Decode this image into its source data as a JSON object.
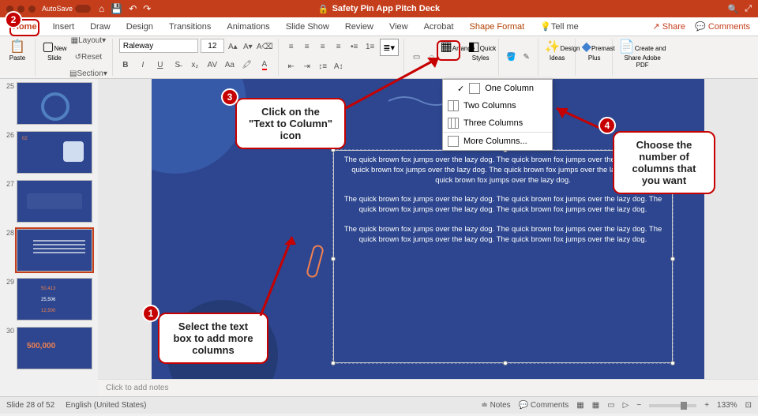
{
  "titlebar": {
    "autosave": "AutoSave",
    "doc": "Safety Pin App Pitch Deck"
  },
  "tabs": [
    "Home",
    "Insert",
    "Draw",
    "Design",
    "Transitions",
    "Animations",
    "Slide Show",
    "Review",
    "View",
    "Acrobat",
    "Shape Format"
  ],
  "tellme": "Tell me",
  "share": "Share",
  "comments": "Comments",
  "ribbon": {
    "paste": "Paste",
    "newslide": "New\nSlide",
    "layout": "Layout",
    "reset": "Reset",
    "section": "Section",
    "font": "Raleway",
    "size": "12",
    "arrange": "Arrange",
    "quickstyles": "Quick\nStyles",
    "designideas": "Design\nIdeas",
    "premast": "Premast\nPlus",
    "adobe": "Create and Share\nAdobe PDF"
  },
  "columns_menu": {
    "one": "One Column",
    "two": "Two Columns",
    "three": "Three Columns",
    "more": "More Columns..."
  },
  "thumbs": [
    25,
    26,
    27,
    28,
    29,
    30
  ],
  "selected_thumb": 28,
  "thumb30_value": "500,000",
  "slide_text": {
    "p1": "The quick brown fox jumps over the lazy dog. The quick brown fox jumps over the lazy dog. The quick brown fox jumps over the lazy dog. The quick brown fox jumps over the lazy dog. The quick brown fox jumps over the lazy dog.",
    "p2": "The quick brown fox jumps over the lazy dog. The quick brown fox jumps over the lazy dog. The quick brown fox jumps over the lazy dog. The quick brown fox jumps over the lazy dog.",
    "p3": "The quick brown fox jumps over the lazy dog. The quick brown fox jumps over the lazy dog. The quick brown fox jumps over the lazy dog. The quick brown fox jumps over the lazy dog."
  },
  "notes_placeholder": "Click to add notes",
  "status": {
    "slide": "Slide 28 of 52",
    "lang": "English (United States)",
    "notes": "Notes",
    "comments": "Comments",
    "zoom": "133%"
  },
  "callouts": {
    "c1": "Select the text box to add more columns",
    "c3": "Click on the \"Text to Column\" icon",
    "c4": "Choose the number of columns that you want"
  }
}
